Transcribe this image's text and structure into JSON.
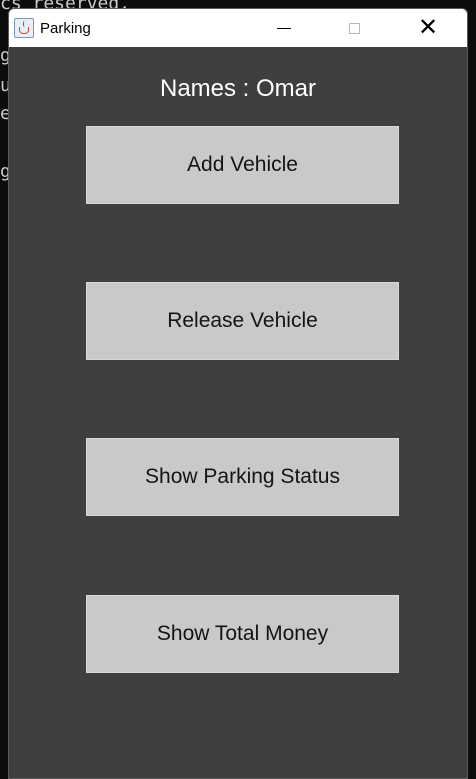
{
  "background_terminal": {
    "lines": [
      "cs reserved.",
      "g",
      "u",
      "e",
      "",
      "g"
    ]
  },
  "window": {
    "title": "Parking",
    "icon": "java-cup-icon",
    "controls": {
      "minimize_icon": "minimize-icon",
      "maximize_icon": "maximize-icon",
      "close_icon": "close-icon"
    }
  },
  "content": {
    "names_label": "Names : Omar",
    "buttons": [
      {
        "label": "Add Vehicle"
      },
      {
        "label": "Release Vehicle"
      },
      {
        "label": "Show Parking Status"
      },
      {
        "label": "Show Total Money"
      }
    ]
  },
  "colors": {
    "window_background": "#3f3f3f",
    "button_background": "#c9c9c9",
    "titlebar_background": "#ffffff"
  }
}
